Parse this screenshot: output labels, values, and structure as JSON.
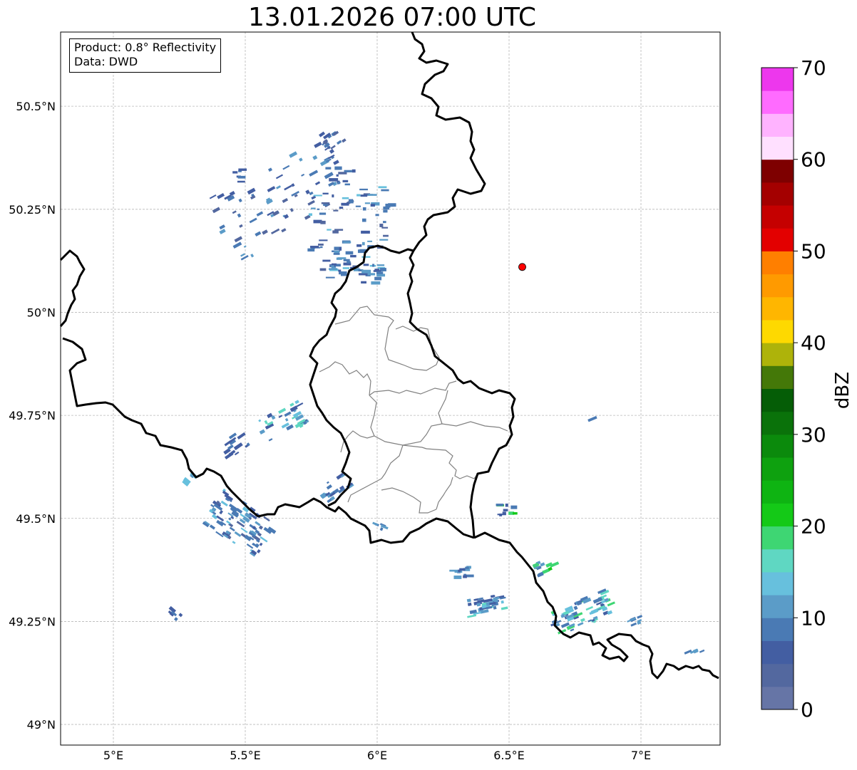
{
  "title": "13.01.2026 07:00 UTC",
  "info": {
    "product": "Product: 0.8° Reflectivity",
    "source": "Data: DWD"
  },
  "map": {
    "lon_range": [
      4.8,
      7.3
    ],
    "lat_range": [
      48.95,
      50.68
    ],
    "lon_ticks": [
      {
        "value": 5.0,
        "label": "5°E"
      },
      {
        "value": 5.5,
        "label": "5.5°E"
      },
      {
        "value": 6.0,
        "label": "6°E"
      },
      {
        "value": 6.5,
        "label": "6.5°E"
      },
      {
        "value": 7.0,
        "label": "7°E"
      }
    ],
    "lat_ticks": [
      {
        "value": 49.0,
        "label": "49°N"
      },
      {
        "value": 49.25,
        "label": "49.25°N"
      },
      {
        "value": 49.5,
        "label": "49.5°N"
      },
      {
        "value": 49.75,
        "label": "49.75°N"
      },
      {
        "value": 50.0,
        "label": "50°N"
      },
      {
        "value": 50.25,
        "label": "50.25°N"
      },
      {
        "value": 50.5,
        "label": "50.5°N"
      }
    ],
    "grid": true,
    "radar_site": {
      "lon": 6.55,
      "lat": 50.11,
      "color": "#ff0000"
    },
    "layers": [
      "national-borders",
      "canton-borders",
      "radar-reflectivity"
    ]
  },
  "colorbar": {
    "label": "dBZ",
    "min": 0,
    "max": 70,
    "tick_labels": [
      "0",
      "10",
      "20",
      "30",
      "40",
      "50",
      "60",
      "70"
    ],
    "colors": [
      "#6675a6",
      "#53689f",
      "#435ea2",
      "#4a7ab4",
      "#5b9cc8",
      "#67c0dd",
      "#5fd7c2",
      "#3ed673",
      "#14c917",
      "#0eb412",
      "#0ea10f",
      "#0b8a0c",
      "#0a720a",
      "#055d06",
      "#447808",
      "#aeb30a",
      "#fed900",
      "#ffb600",
      "#ff9a00",
      "#ff7f00",
      "#e30000",
      "#c50000",
      "#a40000",
      "#7e0000",
      "#ffe0ff",
      "#ffb3ff",
      "#ff6bff",
      "#ed37ed"
    ]
  }
}
